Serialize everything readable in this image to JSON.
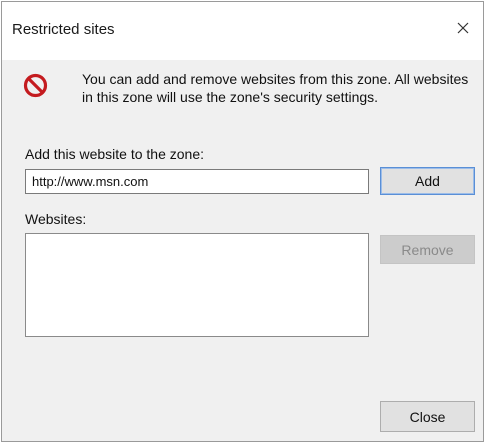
{
  "dialog": {
    "title": "Restricted sites",
    "message": "You can add and remove websites from this zone. All websites in this zone will use the zone's security settings.",
    "icon": "restricted-icon",
    "close_glyph": "×"
  },
  "add_section": {
    "label": "Add this website to the zone:",
    "input_value": "http://www.msn.com",
    "add_label": "Add"
  },
  "websites_section": {
    "label": "Websites:",
    "items": [],
    "remove_label": "Remove"
  },
  "footer": {
    "close_label": "Close"
  },
  "colors": {
    "restricted_icon": "#c41b1f",
    "dialog_bg": "#f0f0f0",
    "default_button_border": "#5a8fd6"
  }
}
